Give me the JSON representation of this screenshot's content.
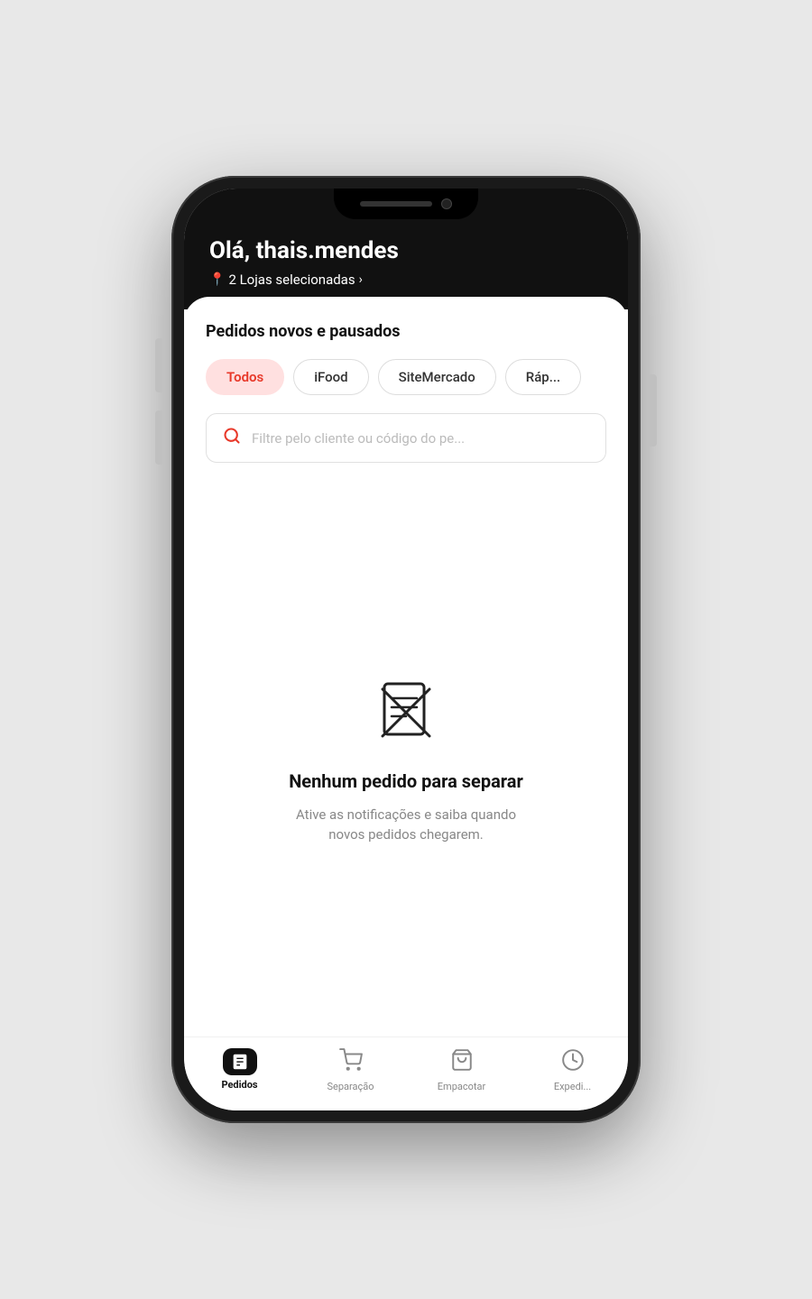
{
  "header": {
    "greeting": "Olá, thais.mendes",
    "location_label": "2 Lojas selecionadas",
    "location_arrow": "›"
  },
  "main": {
    "section_title": "Pedidos novos e pausados",
    "filters": [
      {
        "id": "todos",
        "label": "Todos",
        "active": true
      },
      {
        "id": "ifood",
        "label": "iFood",
        "active": false
      },
      {
        "id": "sitemercado",
        "label": "SiteMercado",
        "active": false
      },
      {
        "id": "rapido",
        "label": "Ráp...",
        "active": false
      }
    ],
    "search_placeholder": "Filtre pelo cliente ou código do pe...",
    "empty_state": {
      "title": "Nenhum pedido para separar",
      "subtitle": "Ative as notificações e saiba quando\nnovos pedidos chegarem."
    }
  },
  "bottom_nav": {
    "items": [
      {
        "id": "pedidos",
        "label": "Pedidos",
        "active": true
      },
      {
        "id": "separacao",
        "label": "Separação",
        "active": false
      },
      {
        "id": "empacotar",
        "label": "Empacotar",
        "active": false
      },
      {
        "id": "expedicao",
        "label": "Expedi...",
        "active": false
      }
    ]
  }
}
